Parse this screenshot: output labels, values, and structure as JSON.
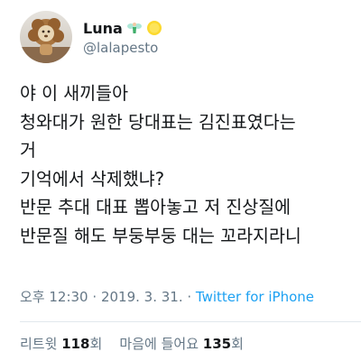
{
  "user": {
    "display_name": "Luna",
    "handle": "@lalapesto",
    "name_emojis": [
      "fairy-icon",
      "sun-icon"
    ]
  },
  "tweet": {
    "lines": [
      "야 이 새끼들아",
      "청와대가 원한 당대표는 김진표였다는",
      "거",
      "기억에서 삭제했냐?",
      "반문 추대 대표 뽑아놓고 저 진상질에",
      "반문질 해도 부둥부둥 대는 꼬라지라니"
    ],
    "time": "오후 12:30",
    "date": "2019. 3. 31.",
    "source": "Twitter for iPhone"
  },
  "stats": {
    "retweets_label": "리트윗",
    "retweets": "118",
    "retweets_unit": "회",
    "likes_label": "마음에 들어요",
    "likes": "135",
    "likes_unit": "회"
  },
  "colors": {
    "text": "#14171a",
    "muted": "#657786",
    "link": "#1da1f2",
    "divider": "#e1e8ed"
  }
}
